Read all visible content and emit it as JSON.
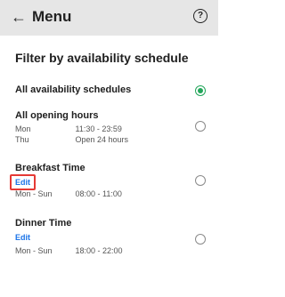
{
  "appbar": {
    "title": "Menu",
    "back_icon": "arrow-left-icon",
    "help_icon": "help-icon"
  },
  "sheet": {
    "title": "Filter by availability schedule",
    "options": [
      {
        "name": "All availability schedules",
        "selected": true
      },
      {
        "name": "All opening hours",
        "hours": [
          {
            "day": "Mon",
            "time": "11:30 - 23:59"
          },
          {
            "day": "Thu",
            "time": "Open 24 hours"
          }
        ],
        "selected": false
      },
      {
        "name": "Breakfast Time",
        "edit_label": "Edit",
        "hours": [
          {
            "day": "Mon - Sun",
            "time": "08:00 - 11:00"
          }
        ],
        "selected": false
      },
      {
        "name": "Dinner Time",
        "edit_label": "Edit",
        "hours": [
          {
            "day": "Mon - Sun",
            "time": "18:00 - 22:00"
          }
        ],
        "selected": false
      }
    ]
  },
  "colors": {
    "accent_green": "#22a65a",
    "link_blue": "#1a73e8",
    "highlight_red": "#e53935"
  }
}
